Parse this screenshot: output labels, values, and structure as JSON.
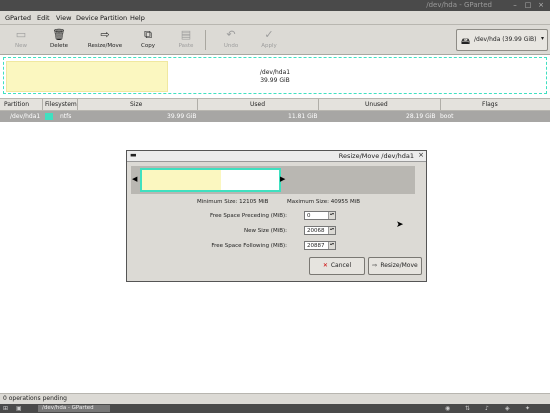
{
  "window": {
    "title": "/dev/hda - GParted"
  },
  "menubar": [
    "GParted",
    "Edit",
    "View",
    "Device",
    "Partition",
    "Help"
  ],
  "toolbar": {
    "new": "New",
    "delete": "Delete",
    "resize_move": "Resize/Move",
    "copy": "Copy",
    "paste": "Paste",
    "undo": "Undo",
    "apply": "Apply"
  },
  "device_selector": "/dev/hda   (39.99 GiB)",
  "map": {
    "name": "/dev/hda1",
    "size": "39.99 GiB",
    "used_fraction": 0.3
  },
  "table": {
    "headers": [
      "Partition",
      "Filesystem",
      "Size",
      "Used",
      "Unused",
      "Flags"
    ],
    "rows": [
      {
        "partition": "/dev/hda1",
        "filesystem": "ntfs",
        "size": "39.99 GiB",
        "used": "11.81 GiB",
        "unused": "28.19 GiB",
        "flags": "boot"
      }
    ]
  },
  "dialog": {
    "title": "Resize/Move /dev/hda1",
    "min_size": "Minimum Size: 12105 MiB",
    "max_size": "Maximum Size: 40955 MiB",
    "fields": [
      {
        "label": "Free Space Preceding (MiB):",
        "value": "0"
      },
      {
        "label": "New Size (MiB):",
        "value": "20068"
      },
      {
        "label": "Free Space Following (MiB):",
        "value": "20887"
      }
    ],
    "cancel": "Cancel",
    "resize": "Resize/Move"
  },
  "status": "0 operations pending",
  "taskbar": {
    "task": "/dev/hda - GParted"
  },
  "colors": {
    "ntfs": "#3fe0c0",
    "used": "#fbf7c0"
  }
}
